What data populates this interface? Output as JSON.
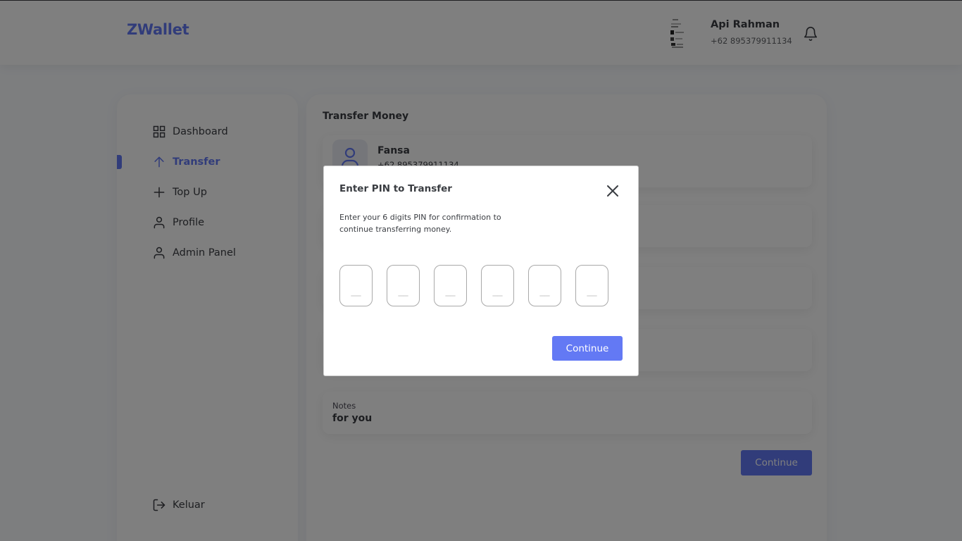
{
  "header": {
    "logo": "ZWallet",
    "user_name": "Api Rahman",
    "user_phone": "+62 895379911134"
  },
  "sidebar": {
    "items": [
      {
        "label": "Dashboard",
        "icon": "grid-icon"
      },
      {
        "label": "Transfer",
        "icon": "arrow-up-icon",
        "active": true
      },
      {
        "label": "Top Up",
        "icon": "plus-icon"
      },
      {
        "label": "Profile",
        "icon": "user-icon"
      },
      {
        "label": "Admin Panel",
        "icon": "user-icon"
      }
    ],
    "logout_label": "Keluar"
  },
  "main": {
    "title": "Transfer Money",
    "recipient": {
      "name": "Fansa",
      "phone": "+62 895379911134"
    },
    "notes": {
      "label": "Notes",
      "value": "for you"
    },
    "continue_label": "Continue"
  },
  "modal": {
    "title": "Enter PIN to Transfer",
    "description": "Enter your 6 digits PIN for confirmation to continue transferring money.",
    "pin_placeholder": "__",
    "continue_label": "Continue"
  },
  "colors": {
    "accent": "#6379f4",
    "text": "#3a3d42",
    "overlay": "rgba(0,0,0,0.5)"
  }
}
